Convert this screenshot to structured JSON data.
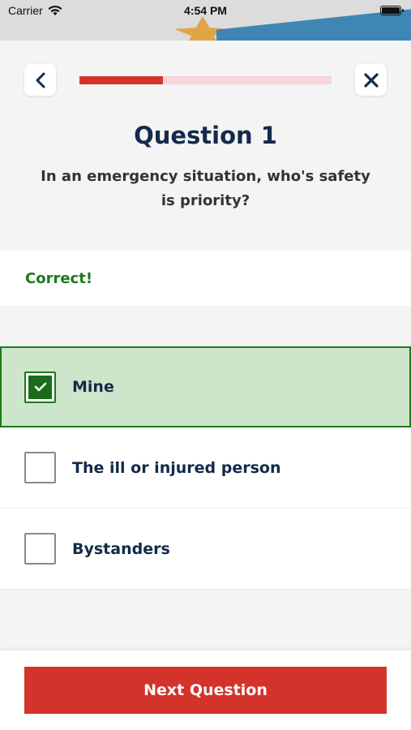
{
  "status_bar": {
    "carrier": "Carrier",
    "time": "4:54 PM",
    "wifi_icon": "wifi-icon",
    "battery_icon": "battery-icon"
  },
  "quiz": {
    "back_icon": "chevron-left-icon",
    "close_icon": "close-icon",
    "progress_fraction": 0.33,
    "progress_color": "#d3332b",
    "progress_track_color": "#f7d4d8",
    "title": "Question 1",
    "question": "In an emergency situation, who's safety is priority?",
    "feedback": "Correct!",
    "feedback_color": "#1b7a1b",
    "answers": [
      {
        "label": "Mine",
        "selected": true,
        "state": "correct"
      },
      {
        "label": "The ill or injured person",
        "selected": false
      },
      {
        "label": "Bystanders",
        "selected": false
      }
    ],
    "next_label": "Next Question",
    "accent_color": "#d3332b"
  }
}
